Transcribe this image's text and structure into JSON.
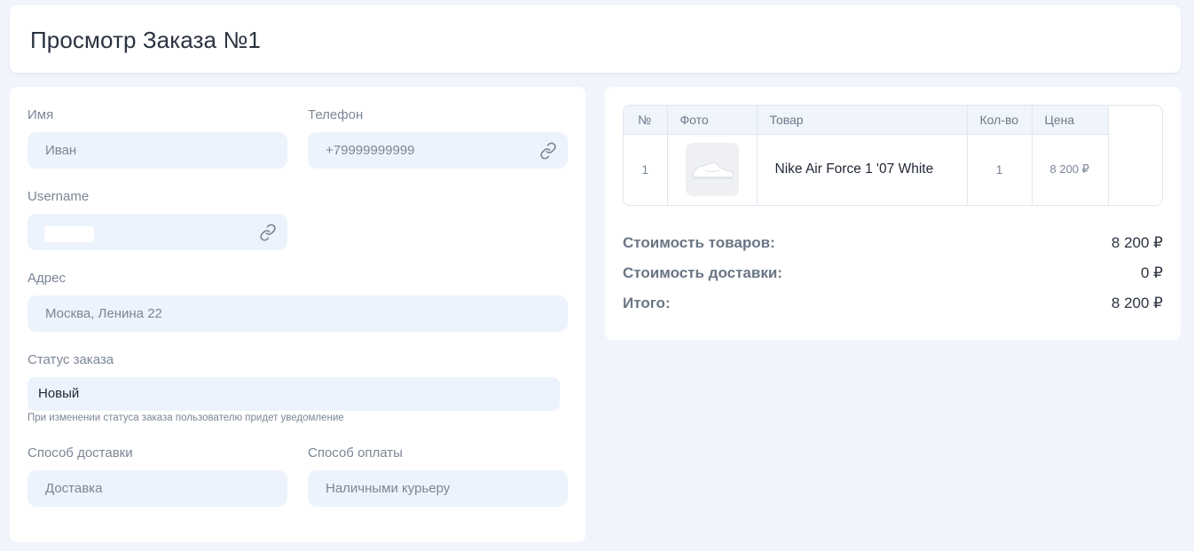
{
  "header": {
    "title": "Просмотр Заказа №1"
  },
  "form": {
    "name": {
      "label": "Имя",
      "value": "Иван"
    },
    "phone": {
      "label": "Телефон",
      "value": "+79999999999"
    },
    "username": {
      "label": "Username",
      "value": ""
    },
    "address": {
      "label": "Адрес",
      "value": "Москва, Ленина 22"
    },
    "status": {
      "label": "Статус заказа",
      "value": "Новый",
      "hint": "При изменении статуса заказа пользователю придет уведомление"
    },
    "delivery": {
      "label": "Способ доставки",
      "value": "Доставка"
    },
    "payment": {
      "label": "Способ оплаты",
      "value": "Наличными курьеру"
    }
  },
  "order_table": {
    "columns": [
      "№",
      "Фото",
      "Товар",
      "Кол-во",
      "Цена"
    ],
    "rows": [
      {
        "num": "1",
        "photo": "sneaker-photo",
        "product": "Nike Air Force 1 '07 White",
        "qty": "1",
        "price": "8 200 ₽"
      }
    ]
  },
  "summary": {
    "goods_label": "Стоимость товаров:",
    "goods_value": "8 200 ₽",
    "delivery_label": "Стоимость доставки:",
    "delivery_value": "0 ₽",
    "total_label": "Итого:",
    "total_value": "8 200 ₽"
  },
  "colors": {
    "background": "#f1f5fb",
    "field_bg": "#edf3fc",
    "label": "#7b8696",
    "link_icon": "#7b8696"
  },
  "icons": {
    "phone_link": "link-icon",
    "username_link": "link-icon"
  }
}
